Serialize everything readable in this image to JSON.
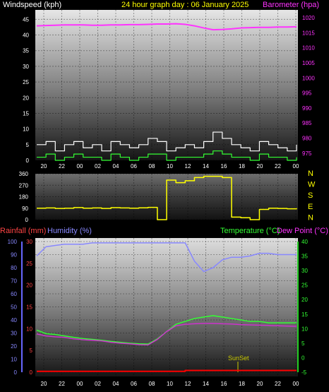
{
  "header": {
    "windspeed_label": "Windspeed (kph)",
    "title": "24 hour graph day : 06 January 2025",
    "barometer_label": "Barometer (hpa)"
  },
  "colors": {
    "windspeed": "#ffffff",
    "gust": "#ffffff",
    "wind_avg": "#33ff33",
    "barometer": "#ff33ff",
    "direction": "#ffff00",
    "humidity": "#8888ff",
    "temperature": "#33ff33",
    "dewpoint": "#cc33cc",
    "rainfall": "#ff0000",
    "sunset": "#cccc00",
    "title": "#ffff00",
    "rain_axis": "#ff4444",
    "hum_axis": "#8888ff",
    "temp_axis": "#33ff33",
    "baro_axis": "#ff33ff"
  },
  "chart_data": [
    {
      "type": "line",
      "name": "wind-barometer",
      "title": "24 hour graph day : 06 January 2025",
      "x_ticks": [
        "20",
        "22",
        "00",
        "02",
        "04",
        "06",
        "08",
        "10",
        "12",
        "14",
        "16",
        "18",
        "20",
        "22",
        "00"
      ],
      "y_left_label": "Windspeed (kph)",
      "y_left_ticks": [
        0,
        5,
        10,
        15,
        20,
        25,
        30,
        35,
        40,
        45
      ],
      "ylim_left": [
        0,
        48
      ],
      "y_right_label": "Barometer (hpa)",
      "y_right_ticks": [
        975,
        980,
        985,
        990,
        995,
        1000,
        1005,
        1010,
        1015,
        1020
      ],
      "ylim_right": [
        972.6,
        1022.6
      ],
      "series": [
        {
          "name": "Barometer",
          "axis": "right",
          "x": [
            0,
            1,
            2,
            3,
            4,
            5,
            6,
            7,
            8,
            9,
            10,
            11,
            12,
            13,
            14,
            15,
            16,
            17,
            18,
            19,
            20,
            21,
            22,
            23,
            24,
            25,
            26,
            27,
            28
          ],
          "y": [
            1017.3,
            1017.4,
            1017.5,
            1017.6,
            1017.6,
            1017.6,
            1017.5,
            1017.5,
            1017.6,
            1017.6,
            1017.7,
            1017.7,
            1017.8,
            1017.9,
            1017.9,
            1018.0,
            1017.8,
            1017.3,
            1016.6,
            1016.0,
            1016.1,
            1016.3,
            1016.6,
            1016.7,
            1016.8,
            1016.8,
            1016.9,
            1016.9,
            1017.0
          ]
        },
        {
          "name": "Gust",
          "axis": "left",
          "x": [
            0,
            1,
            2,
            3,
            4,
            5,
            6,
            7,
            8,
            9,
            10,
            11,
            12,
            13,
            14,
            15,
            16,
            17,
            18,
            19,
            20,
            21,
            22,
            23,
            24,
            25,
            26,
            27,
            28
          ],
          "y": [
            5,
            6,
            3,
            5,
            6,
            4,
            5,
            3,
            6,
            5,
            4,
            5,
            7,
            6,
            3,
            4,
            5,
            4,
            6,
            9,
            7,
            5,
            4,
            3,
            6,
            5,
            4,
            3,
            5
          ]
        },
        {
          "name": "Wind",
          "axis": "left",
          "x": [
            0,
            1,
            2,
            3,
            4,
            5,
            6,
            7,
            8,
            9,
            10,
            11,
            12,
            13,
            14,
            15,
            16,
            17,
            18,
            19,
            20,
            21,
            22,
            23,
            24,
            25,
            26,
            27,
            28
          ],
          "y": [
            1,
            2,
            0,
            1,
            2,
            1,
            1,
            0,
            2,
            1,
            0,
            1,
            2,
            2,
            0,
            1,
            1,
            1,
            2,
            3,
            2,
            1,
            1,
            0,
            2,
            1,
            1,
            0,
            1
          ]
        }
      ]
    },
    {
      "type": "line",
      "name": "wind-direction",
      "y_ticks": [
        0,
        90,
        180,
        270,
        360
      ],
      "ylim": [
        0,
        360
      ],
      "compass_labels": [
        "N",
        "W",
        "S",
        "E",
        "N"
      ],
      "series": [
        {
          "name": "Direction",
          "x": [
            0,
            1,
            2,
            3,
            4,
            5,
            6,
            7,
            8,
            9,
            10,
            11,
            12,
            13,
            14,
            15,
            16,
            17,
            18,
            19,
            20,
            21,
            22,
            23,
            24,
            25,
            26,
            27,
            28
          ],
          "y": [
            90,
            92,
            88,
            90,
            95,
            90,
            92,
            88,
            94,
            92,
            90,
            93,
            96,
            0,
            310,
            290,
            305,
            330,
            340,
            340,
            330,
            20,
            15,
            0,
            80,
            90,
            88,
            85,
            90
          ]
        }
      ]
    },
    {
      "type": "line",
      "name": "rain-humidity-temperature",
      "rainfall_label": "Rainfall (mm)",
      "humidity_label": "Humidity (%)",
      "temperature_label": "Temperature (°C)",
      "dewpoint_label": "Dew Point (°C)",
      "x_ticks": [
        "20",
        "22",
        "00",
        "02",
        "04",
        "06",
        "08",
        "10",
        "12",
        "14",
        "16",
        "18",
        "20",
        "22",
        "00"
      ],
      "y_rain_ticks": [
        0,
        5,
        10,
        15,
        20,
        25,
        30
      ],
      "ylim_rain": [
        0,
        30
      ],
      "y_hum_ticks": [
        0,
        10,
        20,
        30,
        40,
        50,
        60,
        70,
        80,
        90,
        100
      ],
      "ylim_hum": [
        0,
        100
      ],
      "y_temp_ticks": [
        -5,
        0,
        5,
        10,
        15,
        20,
        25,
        30,
        35,
        40
      ],
      "ylim_temp": [
        -5,
        40
      ],
      "annotation": "SunSet",
      "series": [
        {
          "name": "Humidity",
          "axis": "humidity",
          "x": [
            0,
            1,
            2,
            3,
            4,
            5,
            6,
            7,
            8,
            9,
            10,
            11,
            12,
            13,
            14,
            15,
            16,
            17,
            18,
            19,
            20,
            21,
            22,
            23,
            24,
            25,
            26,
            27,
            28
          ],
          "y": [
            89,
            96,
            97,
            98,
            98,
            98,
            99,
            99,
            99,
            99,
            99,
            99,
            99,
            99,
            99,
            99,
            99,
            85,
            77,
            80,
            86,
            88,
            88,
            89,
            91,
            91,
            90,
            90,
            90
          ]
        },
        {
          "name": "Temperature",
          "axis": "temp",
          "x": [
            0,
            1,
            2,
            3,
            4,
            5,
            6,
            7,
            8,
            9,
            10,
            11,
            12,
            13,
            14,
            15,
            16,
            17,
            18,
            19,
            20,
            21,
            22,
            23,
            24,
            25,
            26,
            27,
            28
          ],
          "y": [
            9.5,
            8.3,
            8.0,
            7.5,
            7.0,
            6.6,
            6.3,
            6.0,
            5.6,
            5.3,
            5.0,
            4.8,
            4.7,
            6.5,
            9.0,
            11.5,
            12.5,
            13.5,
            14.0,
            14.5,
            14.0,
            13.5,
            13.0,
            12.5,
            12.5,
            12.0,
            12.0,
            12.0,
            12.0
          ]
        },
        {
          "name": "Dew Point",
          "axis": "temp",
          "x": [
            0,
            1,
            2,
            3,
            4,
            5,
            6,
            7,
            8,
            9,
            10,
            11,
            12,
            13,
            14,
            15,
            16,
            17,
            18,
            19,
            20,
            21,
            22,
            23,
            24,
            25,
            26,
            27,
            28
          ],
          "y": [
            8.2,
            7.5,
            7.2,
            7.0,
            6.5,
            6.2,
            6.0,
            5.8,
            5.3,
            5.0,
            4.8,
            4.5,
            4.4,
            6.3,
            9.0,
            11.0,
            11.5,
            11.7,
            11.8,
            11.8,
            11.7,
            11.6,
            11.4,
            11.3,
            11.2,
            11.1,
            11.0,
            10.9,
            10.8
          ]
        },
        {
          "name": "Rainfall",
          "axis": "rain",
          "x": [
            0,
            1,
            2,
            3,
            4,
            5,
            6,
            7,
            8,
            9,
            10,
            11,
            12,
            13,
            14,
            15,
            16,
            17,
            18,
            19,
            20,
            21,
            22,
            23,
            24,
            25,
            26,
            27,
            28
          ],
          "y": [
            0.2,
            0.2,
            0.2,
            0.2,
            0.2,
            0.2,
            0.2,
            0.2,
            0.2,
            0.2,
            0.2,
            0.2,
            0.2,
            0.2,
            0.2,
            0.2,
            0.4,
            0.4,
            0.4,
            0.4,
            0.4,
            0.4,
            0.4,
            0.4,
            0.4,
            0.4,
            0.4,
            0.4,
            0.4
          ]
        }
      ]
    }
  ]
}
